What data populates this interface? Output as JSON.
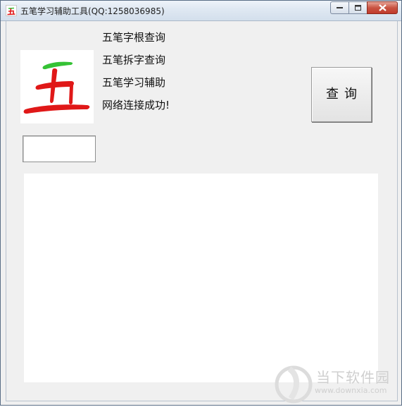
{
  "window": {
    "title": "五笔学习辅助工具(QQ:1258036985)",
    "icon": "wu-character-icon",
    "controls": [
      "minimize-icon",
      "maximize-icon",
      "close-icon"
    ]
  },
  "logo": {
    "character": "五",
    "stroke_top_color": "#35c235",
    "body_color": "#e01818"
  },
  "info": {
    "line1": "五笔字根查询",
    "line2": "五笔拆字查询",
    "line3": "五笔学习辅助",
    "status": "网络连接成功!"
  },
  "query_button": {
    "label": "查询"
  },
  "char_input": {
    "value": ""
  },
  "result": {
    "content": ""
  },
  "watermark": {
    "brand": "当下软件园",
    "url": "www.downxia.com"
  }
}
